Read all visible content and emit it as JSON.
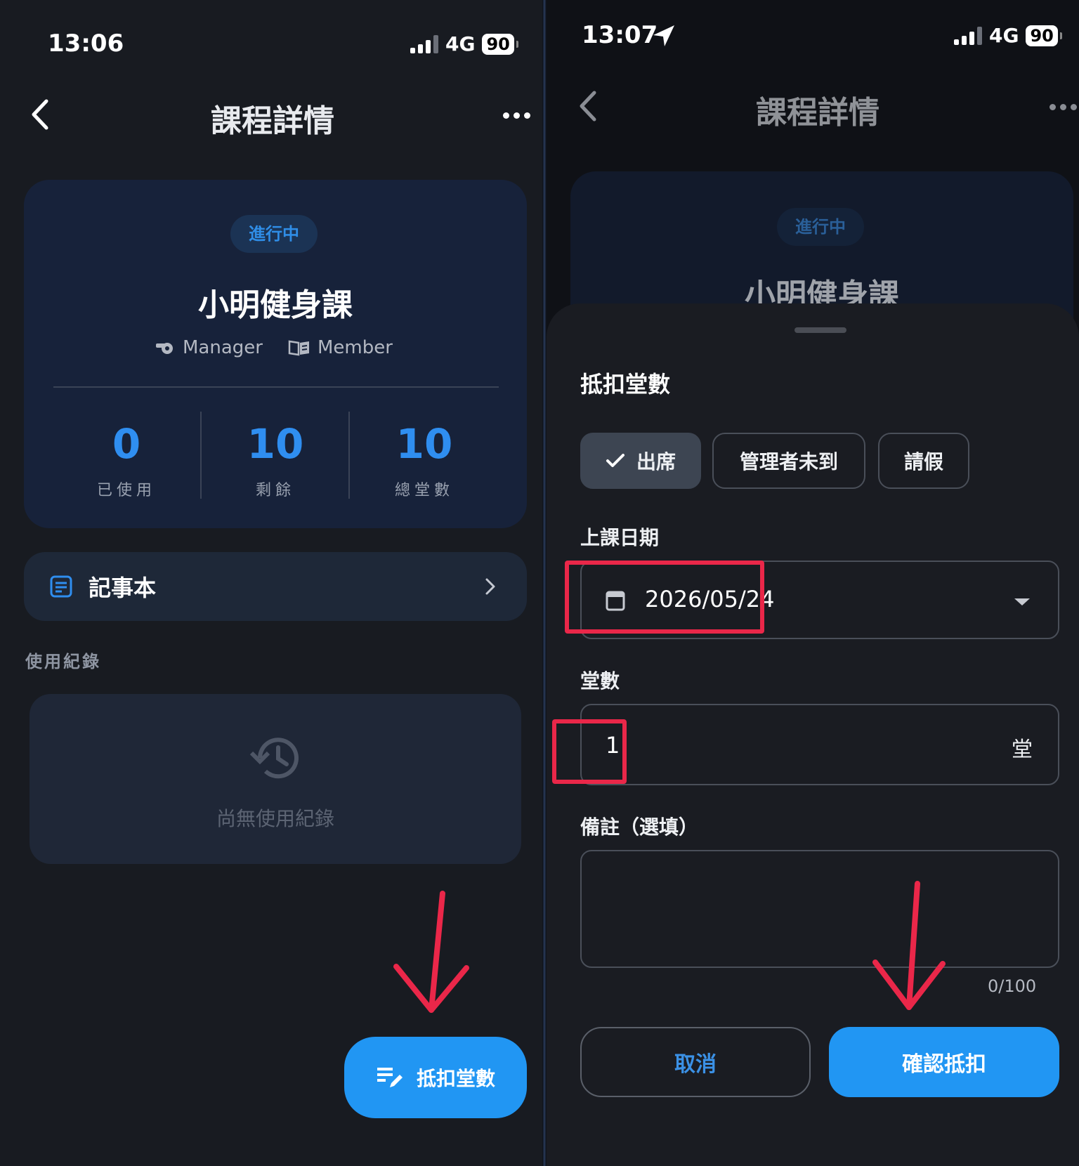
{
  "left": {
    "status_bar": {
      "time": "13:06",
      "network": "4G",
      "battery": "90"
    },
    "nav": {
      "title": "課程詳情"
    },
    "course": {
      "status": "進行中",
      "name": "小明健身課",
      "manager_label": "Manager",
      "member_label": "Member",
      "stats": [
        {
          "value": "0",
          "label": "已使用"
        },
        {
          "value": "10",
          "label": "剩餘"
        },
        {
          "value": "10",
          "label": "總堂數"
        }
      ]
    },
    "notebook_label": "記事本",
    "history_section": "使用紀錄",
    "empty_history": "尚無使用紀錄",
    "fab_label": "抵扣堂數"
  },
  "right": {
    "status_bar": {
      "time": "13:07",
      "network": "4G",
      "battery": "90"
    },
    "nav": {
      "title": "課程詳情"
    },
    "background": {
      "status": "進行中",
      "name": "小明健身課"
    },
    "sheet": {
      "title": "抵扣堂數",
      "options": [
        {
          "label": "出席",
          "selected": true
        },
        {
          "label": "管理者未到",
          "selected": false
        },
        {
          "label": "請假",
          "selected": false
        }
      ],
      "date_label": "上課日期",
      "date_value": "2026/05/24",
      "count_label": "堂數",
      "count_value": "1",
      "count_unit": "堂",
      "note_label": "備註（選填）",
      "note_value": "",
      "note_counter": "0/100",
      "cancel_label": "取消",
      "confirm_label": "確認抵扣"
    }
  },
  "colors": {
    "accent": "#2196f3",
    "annotation": "#ea2749"
  }
}
